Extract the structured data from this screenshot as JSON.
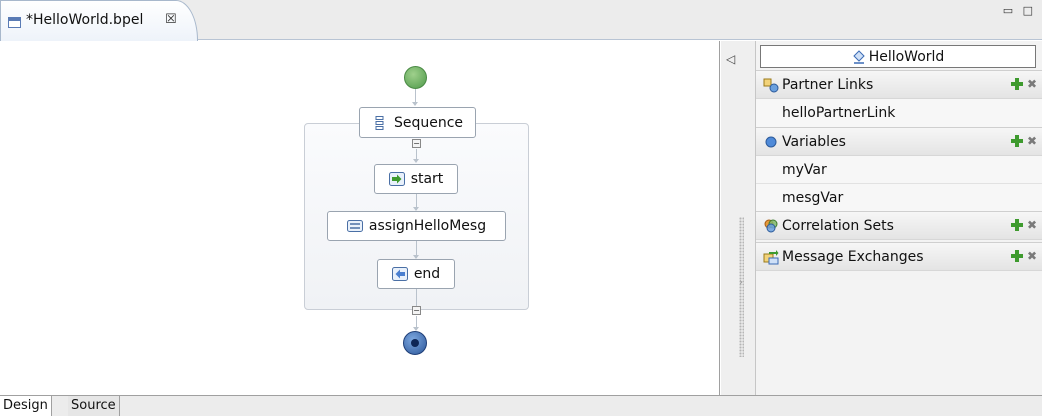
{
  "editor": {
    "tab_title": "*HelloWorld.bpel",
    "close_glyph": "☒",
    "window_buttons": {
      "minimize": "▭",
      "maximize": "□"
    }
  },
  "diagram": {
    "nodes": {
      "sequence": "Sequence",
      "start": "start",
      "assign": "assignHelloMesg",
      "end": "end"
    },
    "collapse_glyph": "−"
  },
  "panel": {
    "process_name": "HelloWorld",
    "sections": {
      "partner_links": {
        "label": "Partner Links",
        "items": [
          "helloPartnerLink"
        ]
      },
      "variables": {
        "label": "Variables",
        "items": [
          "myVar",
          "mesgVar"
        ]
      },
      "correlation_sets": {
        "label": "Correlation Sets"
      },
      "message_exchanges": {
        "label": "Message Exchanges"
      }
    },
    "delete_glyph": "✖",
    "collapse_glyph": "◁",
    "expand_glyph": "›"
  },
  "bottom_tabs": {
    "design": "Design",
    "source": "Source"
  },
  "colors": {
    "start_event": "#5aa653",
    "end_event": "#2b5699",
    "add_icon": "#3e9a2e"
  }
}
